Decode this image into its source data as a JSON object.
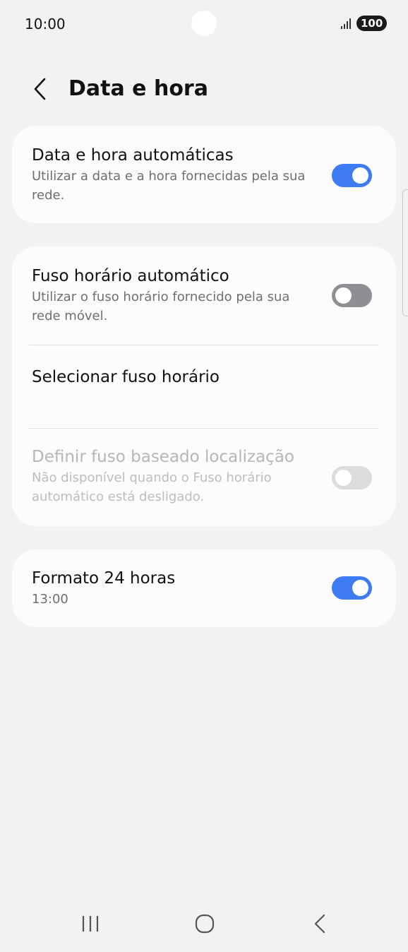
{
  "status_bar": {
    "time": "10:00",
    "battery": "100",
    "icons": [
      "signal-icon",
      "camera-cutout"
    ]
  },
  "header": {
    "title": "Data e hora",
    "back_icon": "chevron-left-icon"
  },
  "cards": {
    "auto_datetime": {
      "title": "Data e hora automáticas",
      "subtitle": "Utilizar a data e a hora fornecidas pela sua rede.",
      "toggle": "on"
    },
    "auto_timezone": {
      "title": "Fuso horário automático",
      "subtitle": "Utilizar o fuso horário fornecido pela sua rede móvel.",
      "toggle": "off"
    },
    "select_timezone": {
      "title": "Selecionar fuso horário"
    },
    "location_timezone": {
      "title": "Definir fuso baseado localização",
      "subtitle": "Não disponível quando o Fuso horário automático está desligado.",
      "toggle": "disabled-off"
    },
    "format_24h": {
      "title": "Formato 24 horas",
      "subtitle": "13:00",
      "toggle": "on"
    }
  },
  "colors": {
    "accent": "#3e7bf0",
    "background": "#f2f2f4",
    "card": "#fcfcfd"
  },
  "nav_bar": {
    "icons": [
      "recents-icon",
      "home-icon",
      "back-icon"
    ]
  }
}
